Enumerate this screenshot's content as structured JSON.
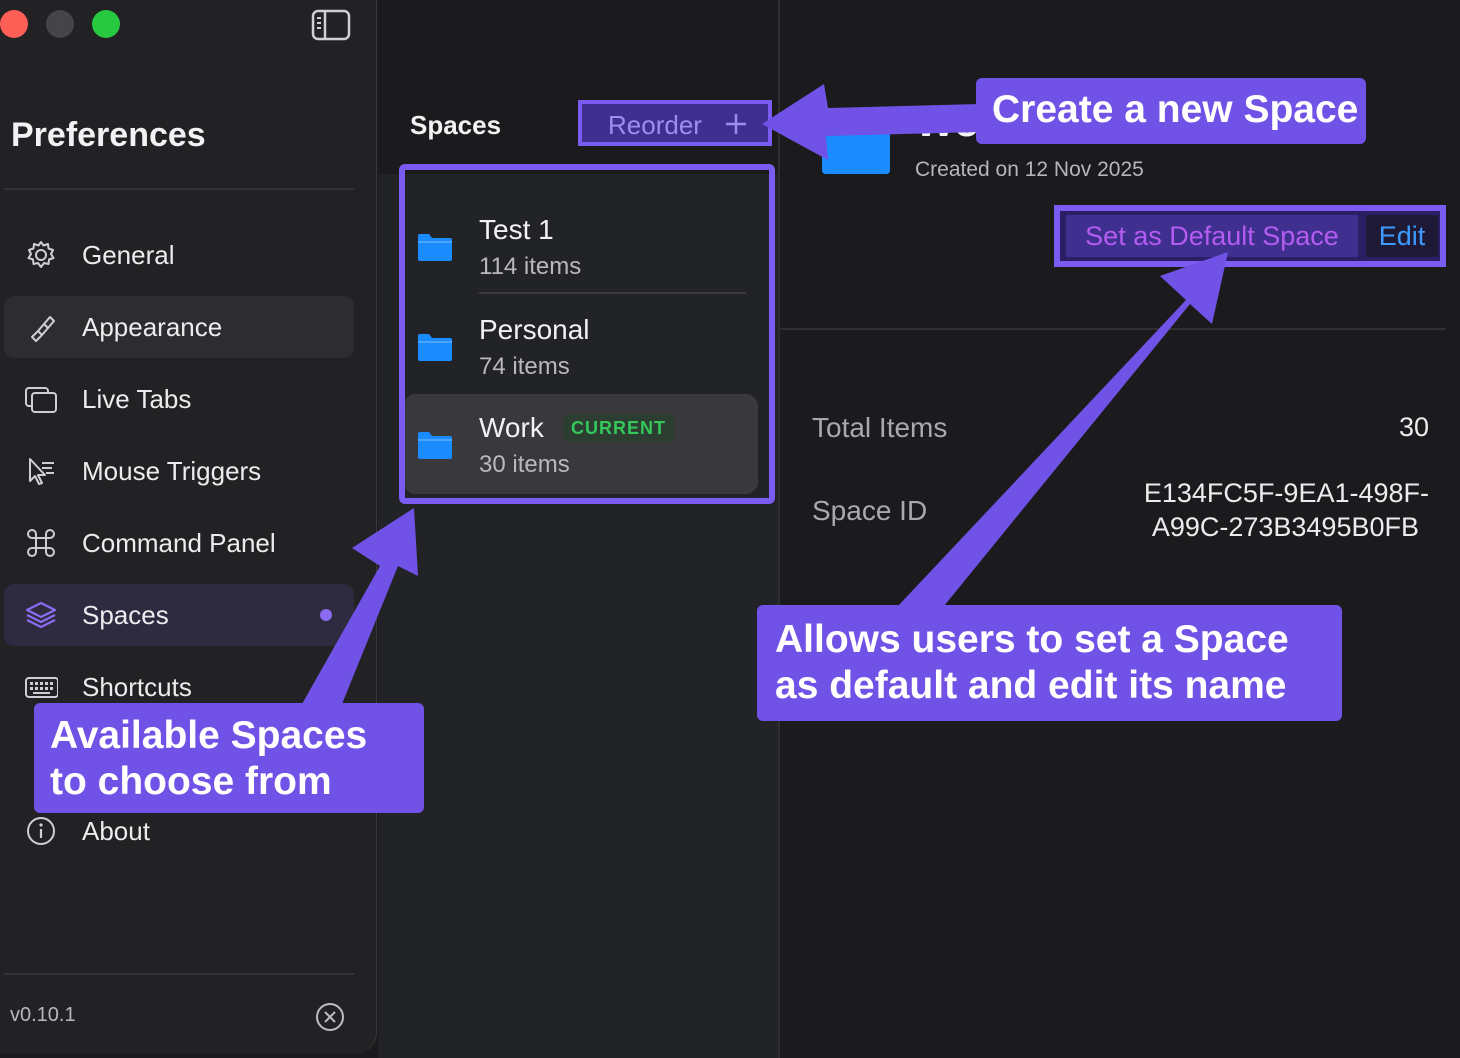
{
  "sidebar": {
    "title": "Preferences",
    "items": [
      {
        "label": "General",
        "icon": "gear-icon"
      },
      {
        "label": "Appearance",
        "icon": "paintbrush-icon"
      },
      {
        "label": "Live Tabs",
        "icon": "tabs-icon"
      },
      {
        "label": "Mouse Triggers",
        "icon": "cursor-click-icon"
      },
      {
        "label": "Command Panel",
        "icon": "command-icon"
      },
      {
        "label": "Spaces",
        "icon": "layers-icon"
      },
      {
        "label": "Shortcuts",
        "icon": "keyboard-icon"
      },
      {
        "label": "About",
        "icon": "info-icon"
      }
    ],
    "version": "v0.10.1"
  },
  "spaces_panel": {
    "title": "Spaces",
    "reorder_label": "Reorder",
    "add_icon": "plus-icon",
    "list": [
      {
        "name": "Test 1",
        "count": "114 items",
        "icon": "folder-icon"
      },
      {
        "name": "Personal",
        "count": "74 items",
        "icon": "folder-icon"
      },
      {
        "name": "Work",
        "count": "30 items",
        "icon": "folder-icon",
        "badge": "CURRENT"
      }
    ]
  },
  "detail": {
    "name_visible": "Wor",
    "created": "Created on 12 Nov 2025",
    "set_default_label": "Set as Default Space",
    "edit_label": "Edit",
    "total_items_label": "Total Items",
    "total_items_value": "30",
    "space_id_label": "Space ID",
    "space_id_line1": "E134FC5F-9EA1-498F-",
    "space_id_line2": "A99C-273B3495B0FB"
  },
  "annotations": {
    "create": "Create a new Space",
    "default_edit": "Allows users to set a Space as default and edit its name",
    "available": "Available Spaces to choose from"
  },
  "colors": {
    "accent": "#7052e6",
    "folder_blue": "#1a8cff",
    "current_badge_text": "#35c75a",
    "edit_blue": "#3d9bff",
    "default_purple": "#b45cf0"
  }
}
